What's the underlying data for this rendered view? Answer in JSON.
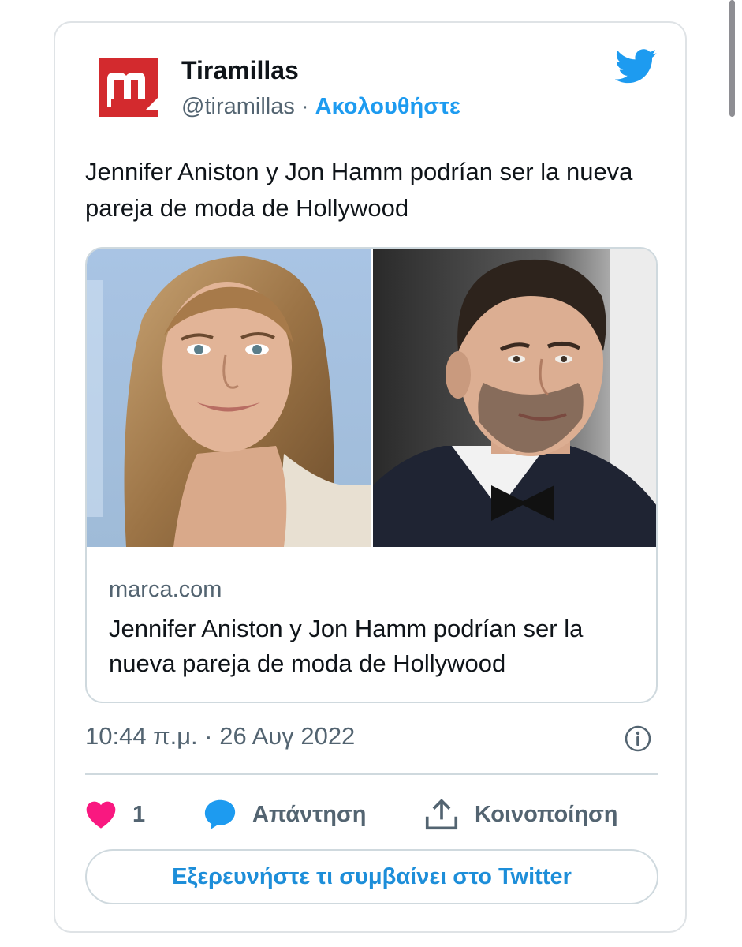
{
  "tweet": {
    "author_name": "Tiramillas",
    "handle": "@tiramillas",
    "separator": "·",
    "follow_label": "Ακολουθήστε",
    "text": "Jennifer Aniston y Jon Hamm podrían ser la nueva pareja de moda de Hollywood",
    "timestamp": "10:44 π.μ. · 26 Αυγ 2022",
    "like_count": "1",
    "reply_label": "Απάντηση",
    "share_label": "Κοινοποίηση",
    "cta_label": "Εξερευνήστε τι συμβαίνει στο Twitter"
  },
  "link_card": {
    "domain": "marca.com",
    "title": "Jennifer Aniston y Jon Hamm podrían ser la nueva pareja de moda de Hollywood"
  },
  "icons": {
    "avatar": "tiramillas-logo",
    "brand": "twitter-bird-icon",
    "info": "info-icon",
    "like": "heart-icon",
    "reply": "speech-bubble-icon",
    "share": "share-upload-icon"
  },
  "colors": {
    "accent": "#1d9bf0",
    "heart": "#f91880",
    "logo_red": "#d32a2e",
    "muted": "#536471",
    "border": "#cfd9de"
  }
}
